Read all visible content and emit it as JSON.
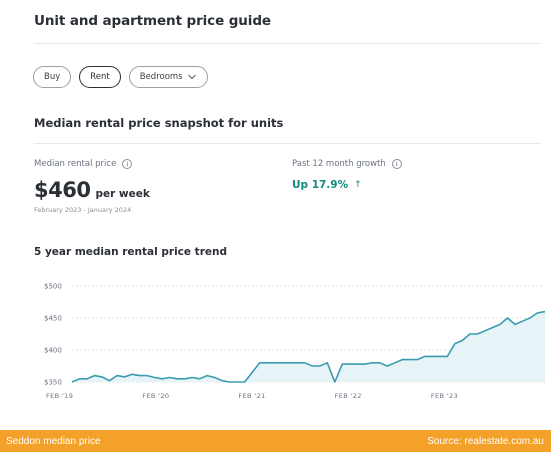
{
  "header": {
    "title": "Unit and apartment price guide"
  },
  "filters": {
    "tabs": [
      {
        "label": "Buy",
        "active": false
      },
      {
        "label": "Rent",
        "active": true
      },
      {
        "label": "Bedrooms",
        "active": false,
        "icon": "chevron-down-icon"
      }
    ]
  },
  "snapshot": {
    "title": "Median rental price snapshot for units",
    "median": {
      "label": "Median rental price",
      "value": "$460",
      "unit": "per week",
      "period": "February 2023 - January 2024",
      "icon": "info-icon"
    },
    "growth": {
      "label": "Past 12 month growth",
      "value": "Up 17.9%",
      "icon": "info-icon",
      "arrow": "↑",
      "color": "#0f8a7e"
    }
  },
  "trend": {
    "title": "5 year median rental price trend"
  },
  "chart_data": {
    "type": "area",
    "ylim": [
      350,
      500
    ],
    "y_ticks": [
      500,
      450,
      400,
      350
    ],
    "y_tick_labels": [
      "$500",
      "$450",
      "$400",
      "$350"
    ],
    "x_tick_labels": [
      "FEB '19",
      "FEB '20",
      "FEB '21",
      "FEB '22",
      "FEB '23"
    ],
    "xlim": [
      0,
      59
    ],
    "x_tick_positions": [
      0,
      12,
      24,
      36,
      48
    ],
    "series": [
      {
        "color": "#3a9bb0",
        "fill": "#e6f4f8",
        "values": [
          350,
          355,
          355,
          360,
          358,
          352,
          360,
          358,
          362,
          360,
          360,
          357,
          355,
          357,
          355,
          355,
          357,
          355,
          360,
          357,
          352,
          350,
          350,
          350,
          365,
          380,
          380,
          380,
          380,
          380,
          380,
          380,
          375,
          375,
          380,
          350,
          378,
          378,
          378,
          378,
          380,
          380,
          375,
          380,
          385,
          385,
          385,
          390,
          390,
          390,
          390,
          410,
          415,
          425,
          425,
          430,
          435,
          440,
          450,
          440,
          445,
          450,
          458,
          460
        ]
      }
    ]
  },
  "banner": {
    "left": "Seddon median price",
    "right": "Source: realestate.com.au",
    "color": "#f4a12a"
  }
}
